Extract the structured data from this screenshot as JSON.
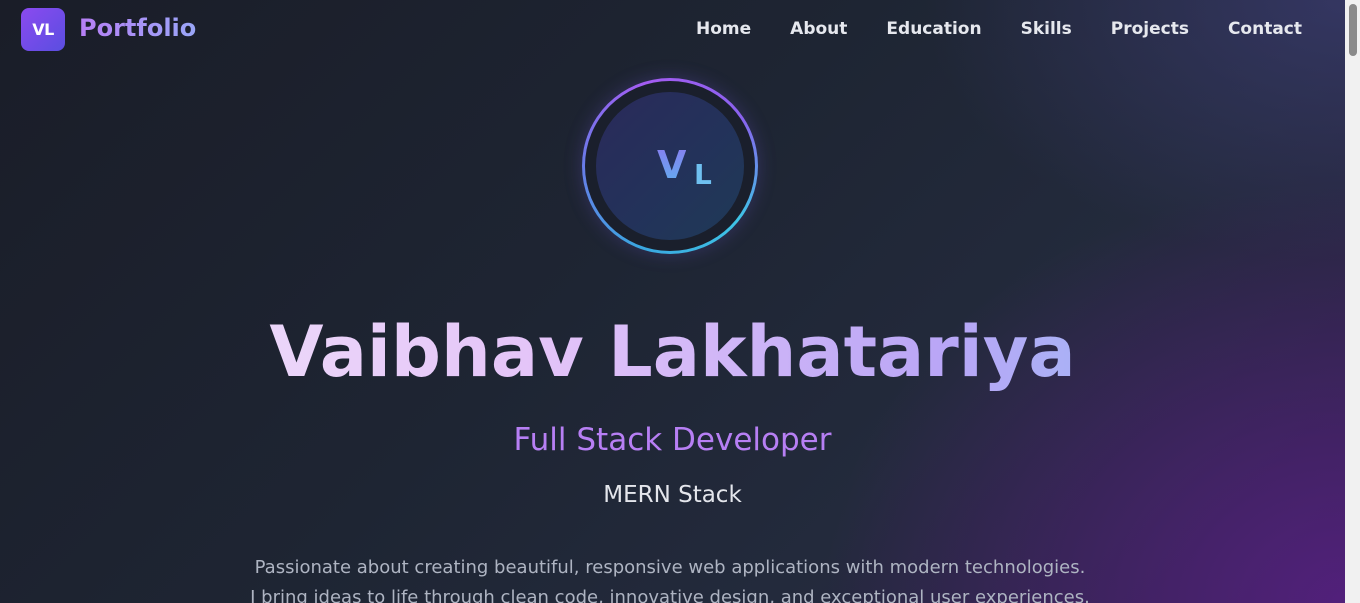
{
  "nav": {
    "logo_text": "VL",
    "brand": "Portfolio",
    "links": [
      "Home",
      "About",
      "Education",
      "Skills",
      "Projects",
      "Contact"
    ]
  },
  "avatar": {
    "initial_first": "V",
    "initial_last": "L"
  },
  "hero": {
    "name": "Vaibhav Lakhatariya",
    "role": "Full Stack Developer",
    "stack": "MERN Stack",
    "description": "Passionate about creating beautiful, responsive web applications with modern technologies. I bring ideas to life through clean code, innovative design, and exceptional user experiences."
  },
  "colors": {
    "background": "#1c2230",
    "accent_purple": "#b77ff4",
    "accent_blue": "#5fb0ef",
    "logo_gradient_start": "#8b4af0",
    "logo_gradient_end": "#5a4ee0"
  }
}
